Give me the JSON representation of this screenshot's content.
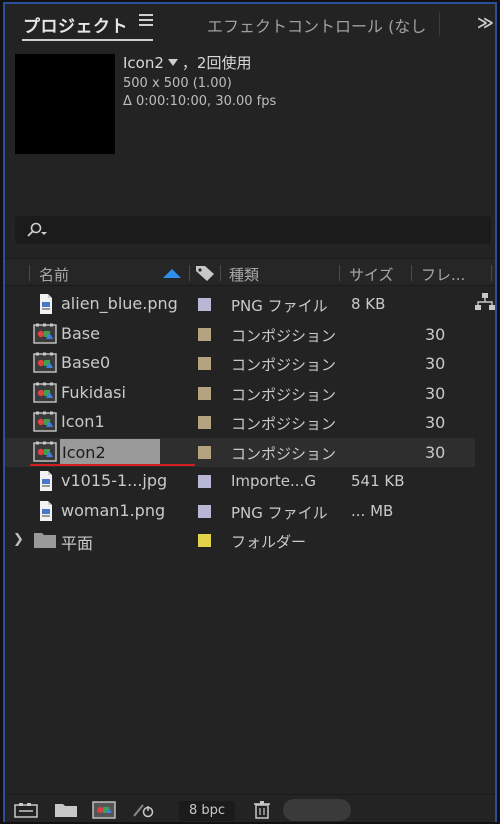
{
  "tabs": {
    "project": "プロジェクト",
    "effects": "エフェクトコントロール (なし",
    "more": "≫"
  },
  "preview": {
    "name": "Icon2",
    "usage": "，2回使用",
    "dimensions": "500 x 500 (1.00)",
    "duration": "Δ 0:00:10:00, 30.00 fps"
  },
  "columns": {
    "name": "名前",
    "type": "種類",
    "size": "サイズ",
    "frames": "フレ"
  },
  "items": [
    {
      "name": "alien_blue.png",
      "type": "PNG ファイル",
      "size": "8 KB",
      "frames": "",
      "icon": "file-icon",
      "label_color": "#b8b8d6",
      "selected": false,
      "expandable": false
    },
    {
      "name": "Base",
      "type": "コンポジション",
      "size": "",
      "frames": "30",
      "icon": "composition-icon",
      "label_color": "#b5a27e",
      "selected": false,
      "expandable": false
    },
    {
      "name": "Base0",
      "type": "コンポジション",
      "size": "",
      "frames": "30",
      "icon": "composition-icon",
      "label_color": "#b5a27e",
      "selected": false,
      "expandable": false
    },
    {
      "name": "Fukidasi",
      "type": "コンポジション",
      "size": "",
      "frames": "30",
      "icon": "composition-icon",
      "label_color": "#b5a27e",
      "selected": false,
      "expandable": false
    },
    {
      "name": "Icon1",
      "type": "コンポジション",
      "size": "",
      "frames": "30",
      "icon": "composition-icon",
      "label_color": "#b5a27e",
      "selected": false,
      "expandable": false
    },
    {
      "name": "Icon2",
      "type": "コンポジション",
      "size": "",
      "frames": "30",
      "icon": "composition-icon",
      "label_color": "#b5a27e",
      "selected": true,
      "expandable": false
    },
    {
      "name": "v1015-1...jpg",
      "type": "Importe...G",
      "size": "541 KB",
      "frames": "",
      "icon": "file-icon",
      "label_color": "#b8b8d6",
      "selected": false,
      "expandable": false
    },
    {
      "name": "woman1.png",
      "type": "PNG ファイル",
      "size": "... MB",
      "frames": "",
      "icon": "file-icon",
      "label_color": "#b8b8d6",
      "selected": false,
      "expandable": false
    },
    {
      "name": "平面",
      "type": "フォルダー",
      "size": "",
      "frames": "",
      "icon": "folder-icon",
      "label_color": "#e3d34a",
      "selected": false,
      "expandable": true
    }
  ],
  "bottombar": {
    "bpc": "8 bpc"
  },
  "colors": {
    "accent": "#2f8ff0",
    "selection_underline": "#d22020",
    "frame_border": "#2d4f9a"
  }
}
